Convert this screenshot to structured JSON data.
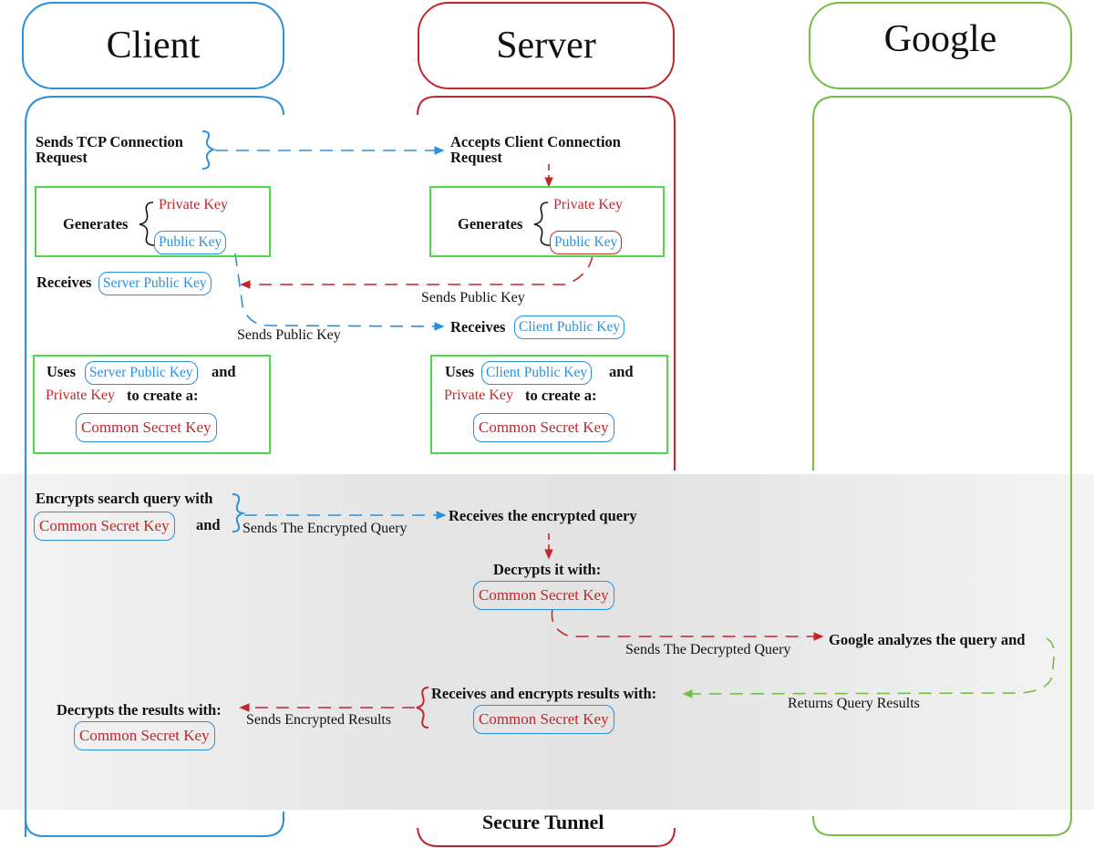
{
  "lanes": {
    "client": {
      "title": "Client",
      "color": "#2b8fdb"
    },
    "server": {
      "title": "Server",
      "color": "#c0262c"
    },
    "google": {
      "title": "Google",
      "color": "#72bf44"
    }
  },
  "colors": {
    "green_box": "#4cd94c",
    "tunnel_bg": "#e4e4e4",
    "text": "#111111"
  },
  "handshake": {
    "client_tcp_line1": "Sends TCP Connection",
    "client_tcp_line2": "Request",
    "server_accept_line1": "Accepts Client Connection",
    "server_accept_line2": "Request",
    "generates": "Generates",
    "private_key": "Private Key",
    "public_key": "Public Key",
    "receives": "Receives",
    "server_public_key": "Server Public Key",
    "client_public_key": "Client Public Key",
    "sends_public_key": "Sends Public Key",
    "uses": "Uses",
    "and": "and",
    "to_create": "to create a:",
    "common_secret_key": "Common Secret Key"
  },
  "tunnel": {
    "title": "Secure Tunnel",
    "encrypts_query": "Encrypts search query with",
    "and": "and",
    "sends_encrypted_query": "Sends The Encrypted Query",
    "receives_encrypted_query": "Receives the encrypted query",
    "decrypts_it_with": "Decrypts it with:",
    "sends_decrypted_query": "Sends The Decrypted Query",
    "google_analyzes": "Google analyzes the query and",
    "returns_query_results": "Returns Query Results",
    "receives_and_encrypts": "Receives and encrypts results with:",
    "sends_encrypted_results": "Sends Encrypted Results",
    "decrypts_results_with": "Decrypts the results with:",
    "common_secret_key": "Common Secret Key"
  }
}
